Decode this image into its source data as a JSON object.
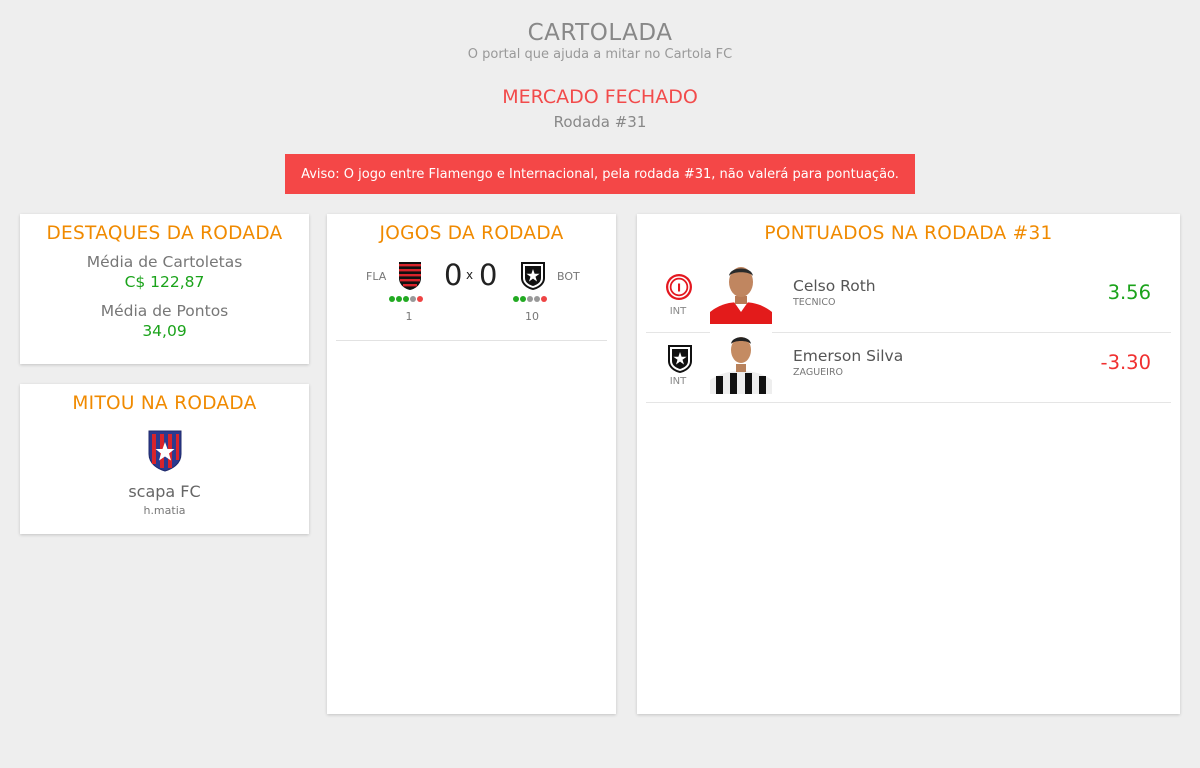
{
  "site": {
    "title": "CARTOLADA",
    "subtitle": "O portal que ajuda a mitar no Cartola FC"
  },
  "market": {
    "status": "MERCADO FECHADO",
    "round": "Rodada #31"
  },
  "alert": {
    "text": "Aviso: O jogo entre Flamengo e Internacional, pela rodada #31, não valerá para pontuação."
  },
  "destaques": {
    "title": "DESTAQUES DA RODADA",
    "media_cartoletas_label": "Média de Cartoletas",
    "media_cartoletas_value": "C$ 122,87",
    "media_pontos_label": "Média de Pontos",
    "media_pontos_value": "34,09"
  },
  "mitou": {
    "title": "MITOU NA RODADA",
    "team_name": "scapa FC",
    "owner": "h.matia"
  },
  "jogos": {
    "title": "JOGOS DA RODADA",
    "games": [
      {
        "home": {
          "abbr": "FLA",
          "position": "1",
          "form": [
            "#22aa22",
            "#22aa22",
            "#22aa22",
            "#999999",
            "#ee4444"
          ]
        },
        "away": {
          "abbr": "BOT",
          "position": "10",
          "form": [
            "#22aa22",
            "#22aa22",
            "#999999",
            "#999999",
            "#ee4444"
          ]
        },
        "home_score": "0",
        "separator": "x",
        "away_score": "0"
      }
    ]
  },
  "pontuados": {
    "title": "PONTUADOS NA RODADA #31",
    "players": [
      {
        "club_abbr": "INT",
        "club_icon": "internacional-crest-icon",
        "name": "Celso Roth",
        "role": "TECNICO",
        "score": "3.56",
        "score_color": "#1ba31b"
      },
      {
        "club_abbr": "INT",
        "club_icon": "botafogo-crest-icon",
        "name": "Emerson Silva",
        "role": "ZAGUEIRO",
        "score": "-3.30",
        "score_color": "#f03030"
      }
    ]
  },
  "colors": {
    "accent": "#f08a00",
    "alert": "#f44747",
    "positive": "#1ba31b",
    "negative": "#f03030"
  }
}
